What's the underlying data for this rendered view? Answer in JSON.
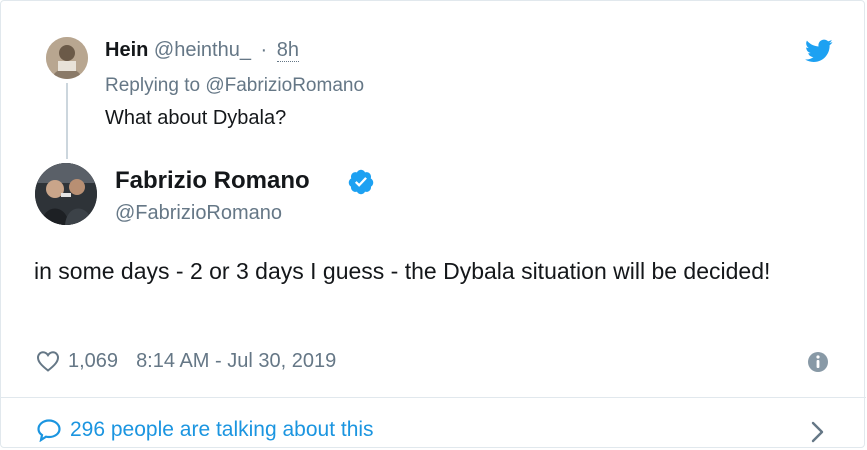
{
  "parent_tweet": {
    "name": "Hein",
    "handle": "@heinthu_",
    "separator": "·",
    "time": "8h",
    "replying_prefix": "Replying to ",
    "replying_to": "@FabrizioRomano",
    "text": "What about Dybala?"
  },
  "tweet": {
    "name": "Fabrizio Romano",
    "handle": "@FabrizioRomano",
    "text": "in some days - 2 or 3 days I guess - the Dybala situation will be decided!",
    "likes": "1,069",
    "timestamp": "8:14 AM - Jul 30, 2019"
  },
  "footer": {
    "talking_text": "296 people are talking about this"
  },
  "icons": {
    "brand": "twitter-bird-icon",
    "verified": "verified-badge-icon",
    "like": "heart-icon",
    "info": "info-icon",
    "conversation": "speech-bubble-icon",
    "open": "chevron-right-icon"
  },
  "colors": {
    "accent": "#1da1f2",
    "link": "#1b95e0",
    "muted": "#657786",
    "text": "#14171a",
    "border": "#e1e8ed"
  }
}
